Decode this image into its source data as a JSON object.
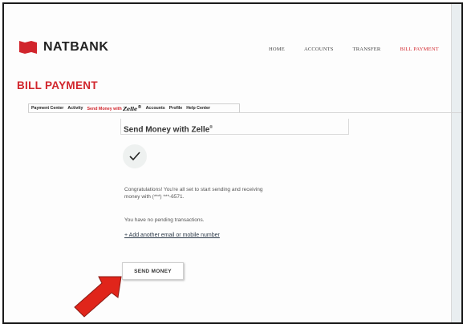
{
  "brand": {
    "name": "NATBANK",
    "logo_icon": "red-flag-logo-icon",
    "accent_color": "#d1252c"
  },
  "nav": {
    "items": [
      {
        "label": "HOME",
        "active": false
      },
      {
        "label": "ACCOUNTS",
        "active": false
      },
      {
        "label": "TRANSFER",
        "active": false
      },
      {
        "label": "BILL PAYMENT",
        "active": true
      }
    ]
  },
  "page": {
    "title": "BILL PAYMENT"
  },
  "tabs": {
    "payment_center": "Payment Center",
    "activity": "Activity",
    "send_money_prefix": "Send Money with",
    "zelle_logo": "Zelle",
    "zelle_reg": "®",
    "accounts": "Accounts",
    "profile": "Profile",
    "help_center": "Help Center",
    "active_tab": "Send Money with Zelle"
  },
  "main": {
    "card_title": "Send Money with Zelle",
    "card_title_reg": "®",
    "success_icon": "checkmark-icon",
    "message_line1": "Congratulations! You're all set to start sending and receiving",
    "message_line2": "money with (***) ***-6571.",
    "pending_text": "You have no pending transactions.",
    "add_link": "+ Add another email or mobile number",
    "send_button": "SEND MONEY"
  },
  "annotation": {
    "pointer": "red-arrow-icon",
    "color": "#e0251b"
  }
}
